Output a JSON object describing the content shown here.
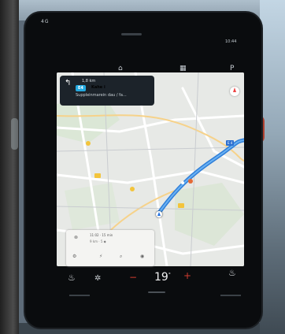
{
  "status_bar": {
    "left": "4G",
    "right": "10:44"
  },
  "top_icons": [
    "profile-icon",
    "car-icon",
    "grid-icon",
    "parking-icon"
  ],
  "top_glyphs": {
    "car": "⌂",
    "grid": "▦",
    "parking": "P"
  },
  "nav_banner": {
    "distance": "1,8 km",
    "road_badge": "E4",
    "road_name": "Kahe i",
    "subtitle": "Suppleinmarein dau / fa..."
  },
  "map": {
    "highway_label": "E 4"
  },
  "route_card": {
    "eta": "11:02 · 15 min",
    "sub": "9 km · 5 ◆"
  },
  "climate": {
    "temperature": "19",
    "unit": "°",
    "minus": "−",
    "plus": "+",
    "seat_left": "♨",
    "fan": "✲",
    "seat_right": "♨"
  },
  "colors": {
    "route": "#2f7ed8",
    "road_badge": "#23a9e0",
    "poi": "#f3c43b",
    "adjust": "#d23c30"
  }
}
